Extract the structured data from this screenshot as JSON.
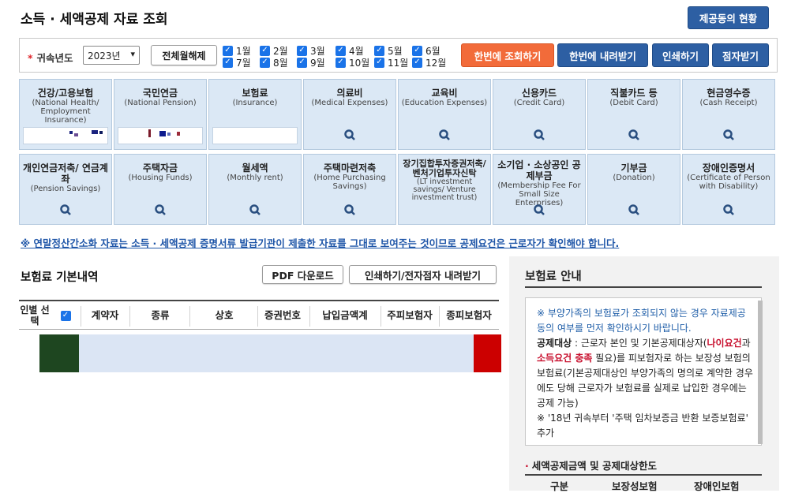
{
  "page": {
    "title": "소득 · 세액공제 자료 조회",
    "status_button": "제공동의 현황"
  },
  "filter": {
    "year_label": "귀속년도",
    "year_value": "2023년",
    "release_all": "전체월해제",
    "months": [
      "1월",
      "2월",
      "3월",
      "4월",
      "5월",
      "6월",
      "7월",
      "8월",
      "9월",
      "10월",
      "11월",
      "12월"
    ],
    "query_button": "한번에 조회하기",
    "download_button": "한번에 내려받기",
    "print_button": "인쇄하기",
    "electronic_button": "점자받기"
  },
  "tiles": [
    {
      "name": "건강/고용보험",
      "sub": "(National Health/ Employment Insurance)"
    },
    {
      "name": "국민연금",
      "sub": "(National Pension)"
    },
    {
      "name": "보험료",
      "sub": "(Insurance)"
    },
    {
      "name": "의료비",
      "sub": "(Medical Expenses)"
    },
    {
      "name": "교육비",
      "sub": "(Education Expenses)"
    },
    {
      "name": "신용카드",
      "sub": "(Credit Card)"
    },
    {
      "name": "직불카드 등",
      "sub": "(Debit Card)"
    },
    {
      "name": "현금영수증",
      "sub": "(Cash Receipt)"
    },
    {
      "name": "개인연금저축/ 연금계좌",
      "sub": "(Pension Savings)"
    },
    {
      "name": "주택자금",
      "sub": "(Housing Funds)"
    },
    {
      "name": "월세액",
      "sub": "(Monthly rent)"
    },
    {
      "name": "주택마련저축",
      "sub": "(Home Purchasing Savings)"
    },
    {
      "name": "장기집합투자증권저축/ 벤처기업투자신탁",
      "sub": "(LT investment savings/ Venture investment trust)"
    },
    {
      "name": "소기업 · 소상공인 공제부금",
      "sub": "(Membership Fee For Small Size Enterprises)"
    },
    {
      "name": "기부금",
      "sub": "(Donation)"
    },
    {
      "name": "장애인증명서",
      "sub": "(Certificate of Person with Disability)"
    }
  ],
  "notice": "※ 연말정산간소화 자료는 소득 · 세액공제 증명서류 발급기관이 제출한 자료를 그대로 보여주는 것이므로 공제요건은 근로자가 확인해야 합니다.",
  "insurance": {
    "title": "보험료 기본내역",
    "pdf_button": "PDF 다운로드",
    "print_button": "인쇄하기/전자점자 내려받기",
    "columns": [
      "인별 선택",
      "계약자",
      "종류",
      "상호",
      "증권번호",
      "납입금액계",
      "주피보험자",
      "종피보험자"
    ]
  },
  "guide": {
    "title": "보험료 안내",
    "line1": "※ 부양가족의 보험료가 조회되지 않는 경우 자료제공동의 여부를 먼저 확인하시기 바랍니다.",
    "deduct_label": "공제대상",
    "deduct_text_a": " : 근로자 본인 및 기본공제대상자(",
    "age_req": "나이요건",
    "and_text": "과 ",
    "income_req": "소득요건 충족",
    "deduct_text_b": " 필요)를 피보험자로 하는 보장성 보험의 보험료(기본공제대상인 부양가족의 명의로 계약한 경우에도 당해 근로자가 보험료를 실제로 납입한 경우에는 공제 가능)",
    "line3": "※ '18년 귀속부터 '주택 임차보증금 반환 보증보험료' 추가",
    "sub_title": "세액공제금액 및 공제대상한도",
    "sub_cols": [
      "구분",
      "보장성보험",
      "장애인보험"
    ]
  },
  "colors": {
    "accent": "#2d5fa3",
    "orange": "#f26b3a",
    "tile_bg": "#dbe8f5",
    "row_left": "#1e4620",
    "row_mid": "#dbe5f4",
    "row_right": "#cc0000"
  }
}
